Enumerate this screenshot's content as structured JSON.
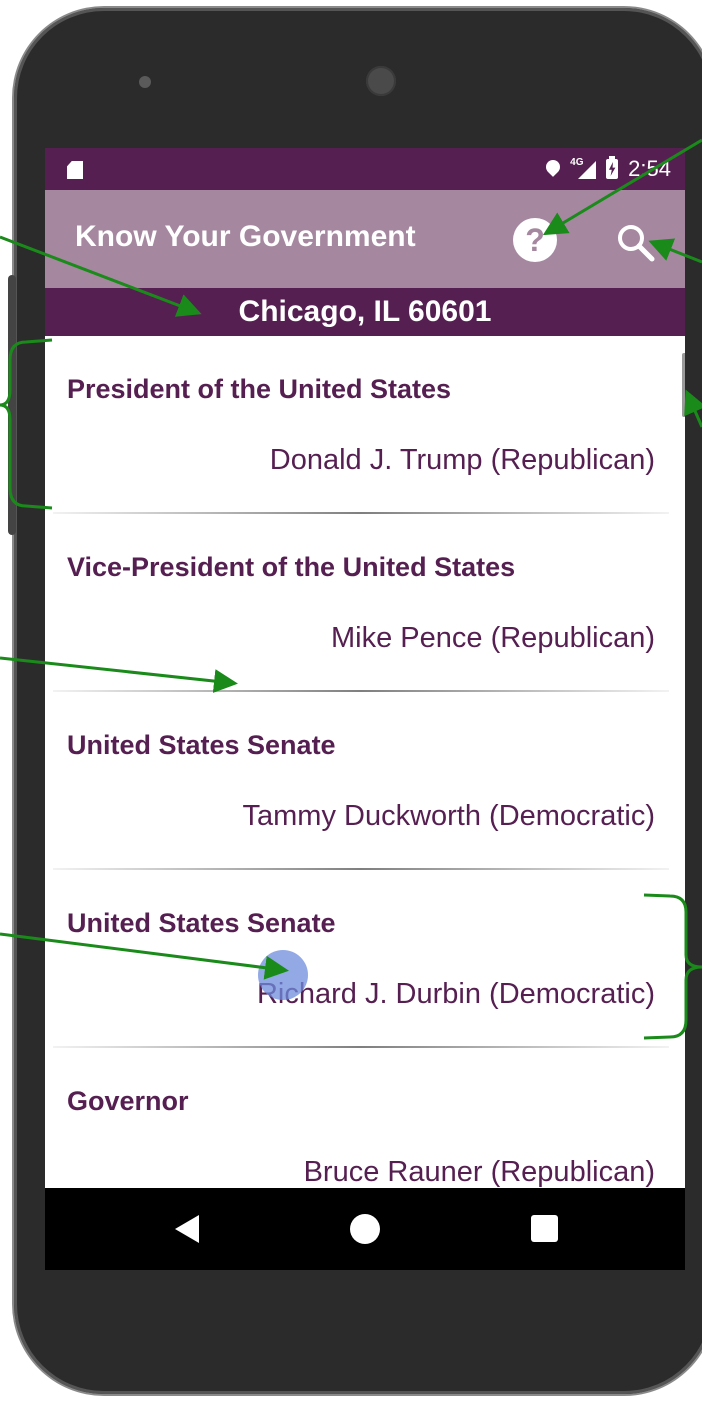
{
  "status_bar": {
    "network": "4G",
    "time": "2:54"
  },
  "app_bar": {
    "title": "Know Your Government",
    "help_icon": "help-circle-icon",
    "search_icon": "search-icon"
  },
  "location": {
    "text": "Chicago, IL 60601"
  },
  "officials": [
    {
      "office": "President of the United States",
      "name": "Donald J. Trump (Republican)"
    },
    {
      "office": "Vice-President of the United States",
      "name": "Mike Pence (Republican)"
    },
    {
      "office": "United States Senate",
      "name": "Tammy Duckworth (Democratic)"
    },
    {
      "office": "United States Senate",
      "name": "Richard J. Durbin (Democratic)"
    },
    {
      "office": "Governor",
      "name": "Bruce Rauner (Republican)"
    }
  ],
  "colors": {
    "primary_dark": "#561f51",
    "primary_light": "#a5889f",
    "annotation": "#1a8a1a"
  }
}
